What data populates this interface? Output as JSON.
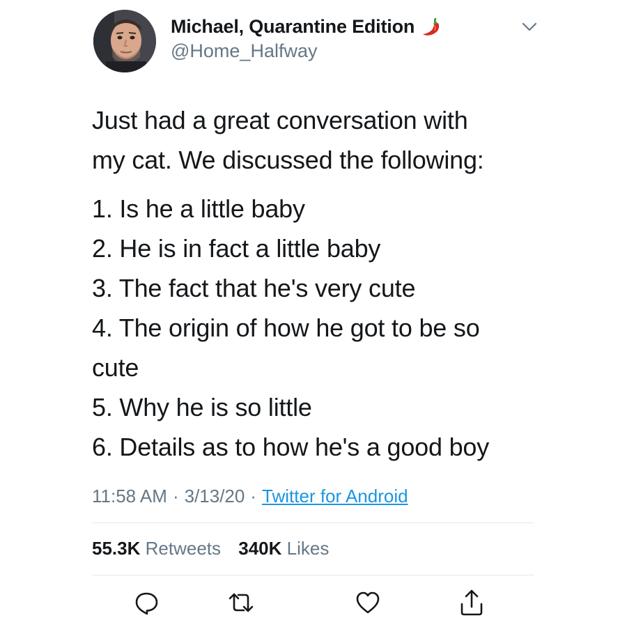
{
  "user": {
    "display_name": "Michael, Quarantine Edition",
    "name_emoji_icon": "hot-pepper-icon",
    "handle": "@Home_Halfway",
    "menu_icon": "chevron-down-icon"
  },
  "tweet": {
    "intro_lines": [
      "Just had a great conversation with",
      "my cat. We discussed the following:"
    ],
    "list": [
      "1. Is he a little baby",
      "2. He is in fact a little baby",
      "3. The fact that he's very cute",
      "4. The origin of how he got to be so",
      "cute",
      "5. Why he is so little",
      "6. Details as to how he's a good boy"
    ]
  },
  "meta": {
    "time": "11:58 AM",
    "separator": "·",
    "date": "3/13/20",
    "source": "Twitter for Android"
  },
  "stats": {
    "retweets_count": "55.3K",
    "retweets_label": "Retweets",
    "likes_count": "340K",
    "likes_label": "Likes"
  },
  "actions": {
    "reply_icon": "reply-icon",
    "retweet_icon": "retweet-icon",
    "like_icon": "heart-icon",
    "share_icon": "share-icon"
  },
  "colors": {
    "text_primary": "#14171a",
    "text_secondary": "#657786",
    "link": "#1b95e0",
    "divider": "#e1e8ed",
    "pepper": "#d62a1e"
  }
}
